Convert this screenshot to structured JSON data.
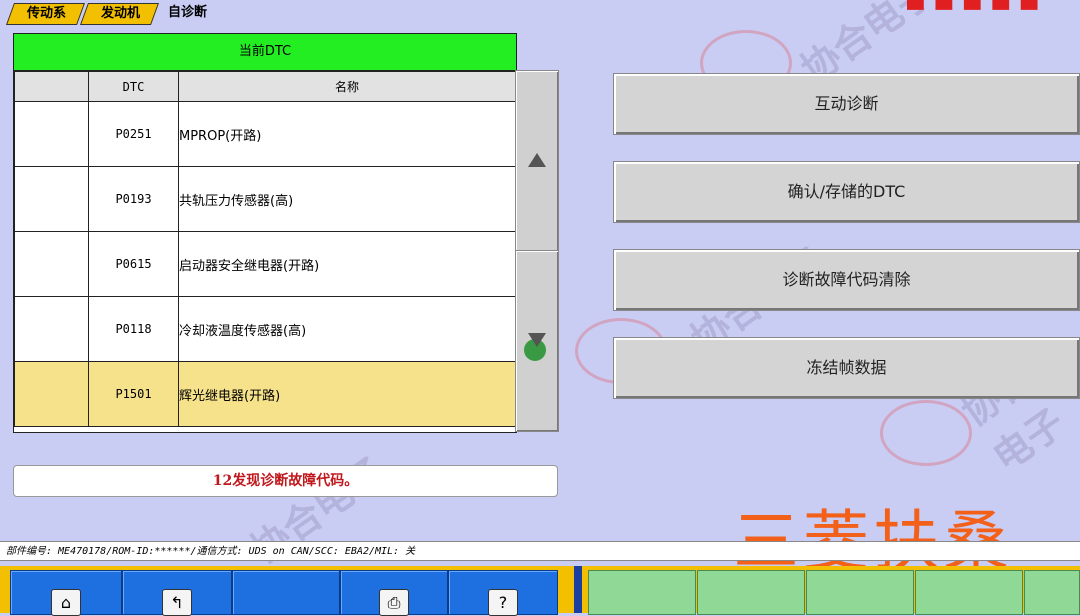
{
  "breadcrumb": [
    "传动系",
    "发动机",
    "自诊断"
  ],
  "dtc_table": {
    "header": "当前DTC",
    "columns": [
      "",
      "DTC",
      "名称"
    ],
    "rows": [
      {
        "code": "P0251",
        "name": "MPROP(开路)"
      },
      {
        "code": "P0193",
        "name": "共轨压力传感器(高)"
      },
      {
        "code": "P0615",
        "name": "启动器安全继电器(开路)"
      },
      {
        "code": "P0118",
        "name": "冷却液温度传感器(高)"
      },
      {
        "code": "P1501",
        "name": "辉光继电器(开路)"
      }
    ]
  },
  "message": "12发现诊断故障代码。",
  "buttons": {
    "b1": "互动诊断",
    "b2": "确认/存储的DTC",
    "b3": "诊断故障代码清除",
    "b4": "冻结帧数据"
  },
  "info_bar": "部件编号: ME470178/ROM-ID:******/通信方式: UDS on CAN/SCC: EBA2/MIL: 关",
  "brand": "三菱扶桑",
  "watermark": "协合电子",
  "colors": {
    "header_green": "#22ee22",
    "highlight": "#f7e28c",
    "brand_orange": "#f2601a"
  }
}
